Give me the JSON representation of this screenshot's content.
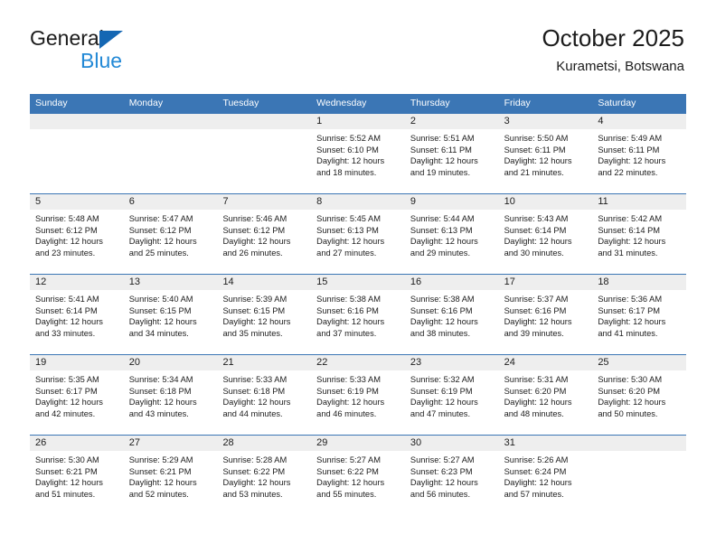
{
  "brand": {
    "name_top": "General",
    "name_bottom": "Blue",
    "accent_blue": "#3b76b5",
    "logo_blue": "#2389d6",
    "logo_triangle_blue": "#1567b3"
  },
  "header": {
    "title": "October 2025",
    "subtitle": "Kurametsi, Botswana"
  },
  "weekdays": [
    "Sunday",
    "Monday",
    "Tuesday",
    "Wednesday",
    "Thursday",
    "Friday",
    "Saturday"
  ],
  "weeks": [
    [
      {
        "day": "",
        "sunrise": "",
        "sunset": "",
        "daylight": ""
      },
      {
        "day": "",
        "sunrise": "",
        "sunset": "",
        "daylight": ""
      },
      {
        "day": "",
        "sunrise": "",
        "sunset": "",
        "daylight": ""
      },
      {
        "day": "1",
        "sunrise": "Sunrise: 5:52 AM",
        "sunset": "Sunset: 6:10 PM",
        "daylight": "Daylight: 12 hours and 18 minutes."
      },
      {
        "day": "2",
        "sunrise": "Sunrise: 5:51 AM",
        "sunset": "Sunset: 6:11 PM",
        "daylight": "Daylight: 12 hours and 19 minutes."
      },
      {
        "day": "3",
        "sunrise": "Sunrise: 5:50 AM",
        "sunset": "Sunset: 6:11 PM",
        "daylight": "Daylight: 12 hours and 21 minutes."
      },
      {
        "day": "4",
        "sunrise": "Sunrise: 5:49 AM",
        "sunset": "Sunset: 6:11 PM",
        "daylight": "Daylight: 12 hours and 22 minutes."
      }
    ],
    [
      {
        "day": "5",
        "sunrise": "Sunrise: 5:48 AM",
        "sunset": "Sunset: 6:12 PM",
        "daylight": "Daylight: 12 hours and 23 minutes."
      },
      {
        "day": "6",
        "sunrise": "Sunrise: 5:47 AM",
        "sunset": "Sunset: 6:12 PM",
        "daylight": "Daylight: 12 hours and 25 minutes."
      },
      {
        "day": "7",
        "sunrise": "Sunrise: 5:46 AM",
        "sunset": "Sunset: 6:12 PM",
        "daylight": "Daylight: 12 hours and 26 minutes."
      },
      {
        "day": "8",
        "sunrise": "Sunrise: 5:45 AM",
        "sunset": "Sunset: 6:13 PM",
        "daylight": "Daylight: 12 hours and 27 minutes."
      },
      {
        "day": "9",
        "sunrise": "Sunrise: 5:44 AM",
        "sunset": "Sunset: 6:13 PM",
        "daylight": "Daylight: 12 hours and 29 minutes."
      },
      {
        "day": "10",
        "sunrise": "Sunrise: 5:43 AM",
        "sunset": "Sunset: 6:14 PM",
        "daylight": "Daylight: 12 hours and 30 minutes."
      },
      {
        "day": "11",
        "sunrise": "Sunrise: 5:42 AM",
        "sunset": "Sunset: 6:14 PM",
        "daylight": "Daylight: 12 hours and 31 minutes."
      }
    ],
    [
      {
        "day": "12",
        "sunrise": "Sunrise: 5:41 AM",
        "sunset": "Sunset: 6:14 PM",
        "daylight": "Daylight: 12 hours and 33 minutes."
      },
      {
        "day": "13",
        "sunrise": "Sunrise: 5:40 AM",
        "sunset": "Sunset: 6:15 PM",
        "daylight": "Daylight: 12 hours and 34 minutes."
      },
      {
        "day": "14",
        "sunrise": "Sunrise: 5:39 AM",
        "sunset": "Sunset: 6:15 PM",
        "daylight": "Daylight: 12 hours and 35 minutes."
      },
      {
        "day": "15",
        "sunrise": "Sunrise: 5:38 AM",
        "sunset": "Sunset: 6:16 PM",
        "daylight": "Daylight: 12 hours and 37 minutes."
      },
      {
        "day": "16",
        "sunrise": "Sunrise: 5:38 AM",
        "sunset": "Sunset: 6:16 PM",
        "daylight": "Daylight: 12 hours and 38 minutes."
      },
      {
        "day": "17",
        "sunrise": "Sunrise: 5:37 AM",
        "sunset": "Sunset: 6:16 PM",
        "daylight": "Daylight: 12 hours and 39 minutes."
      },
      {
        "day": "18",
        "sunrise": "Sunrise: 5:36 AM",
        "sunset": "Sunset: 6:17 PM",
        "daylight": "Daylight: 12 hours and 41 minutes."
      }
    ],
    [
      {
        "day": "19",
        "sunrise": "Sunrise: 5:35 AM",
        "sunset": "Sunset: 6:17 PM",
        "daylight": "Daylight: 12 hours and 42 minutes."
      },
      {
        "day": "20",
        "sunrise": "Sunrise: 5:34 AM",
        "sunset": "Sunset: 6:18 PM",
        "daylight": "Daylight: 12 hours and 43 minutes."
      },
      {
        "day": "21",
        "sunrise": "Sunrise: 5:33 AM",
        "sunset": "Sunset: 6:18 PM",
        "daylight": "Daylight: 12 hours and 44 minutes."
      },
      {
        "day": "22",
        "sunrise": "Sunrise: 5:33 AM",
        "sunset": "Sunset: 6:19 PM",
        "daylight": "Daylight: 12 hours and 46 minutes."
      },
      {
        "day": "23",
        "sunrise": "Sunrise: 5:32 AM",
        "sunset": "Sunset: 6:19 PM",
        "daylight": "Daylight: 12 hours and 47 minutes."
      },
      {
        "day": "24",
        "sunrise": "Sunrise: 5:31 AM",
        "sunset": "Sunset: 6:20 PM",
        "daylight": "Daylight: 12 hours and 48 minutes."
      },
      {
        "day": "25",
        "sunrise": "Sunrise: 5:30 AM",
        "sunset": "Sunset: 6:20 PM",
        "daylight": "Daylight: 12 hours and 50 minutes."
      }
    ],
    [
      {
        "day": "26",
        "sunrise": "Sunrise: 5:30 AM",
        "sunset": "Sunset: 6:21 PM",
        "daylight": "Daylight: 12 hours and 51 minutes."
      },
      {
        "day": "27",
        "sunrise": "Sunrise: 5:29 AM",
        "sunset": "Sunset: 6:21 PM",
        "daylight": "Daylight: 12 hours and 52 minutes."
      },
      {
        "day": "28",
        "sunrise": "Sunrise: 5:28 AM",
        "sunset": "Sunset: 6:22 PM",
        "daylight": "Daylight: 12 hours and 53 minutes."
      },
      {
        "day": "29",
        "sunrise": "Sunrise: 5:27 AM",
        "sunset": "Sunset: 6:22 PM",
        "daylight": "Daylight: 12 hours and 55 minutes."
      },
      {
        "day": "30",
        "sunrise": "Sunrise: 5:27 AM",
        "sunset": "Sunset: 6:23 PM",
        "daylight": "Daylight: 12 hours and 56 minutes."
      },
      {
        "day": "31",
        "sunrise": "Sunrise: 5:26 AM",
        "sunset": "Sunset: 6:24 PM",
        "daylight": "Daylight: 12 hours and 57 minutes."
      },
      {
        "day": "",
        "sunrise": "",
        "sunset": "",
        "daylight": ""
      }
    ]
  ]
}
